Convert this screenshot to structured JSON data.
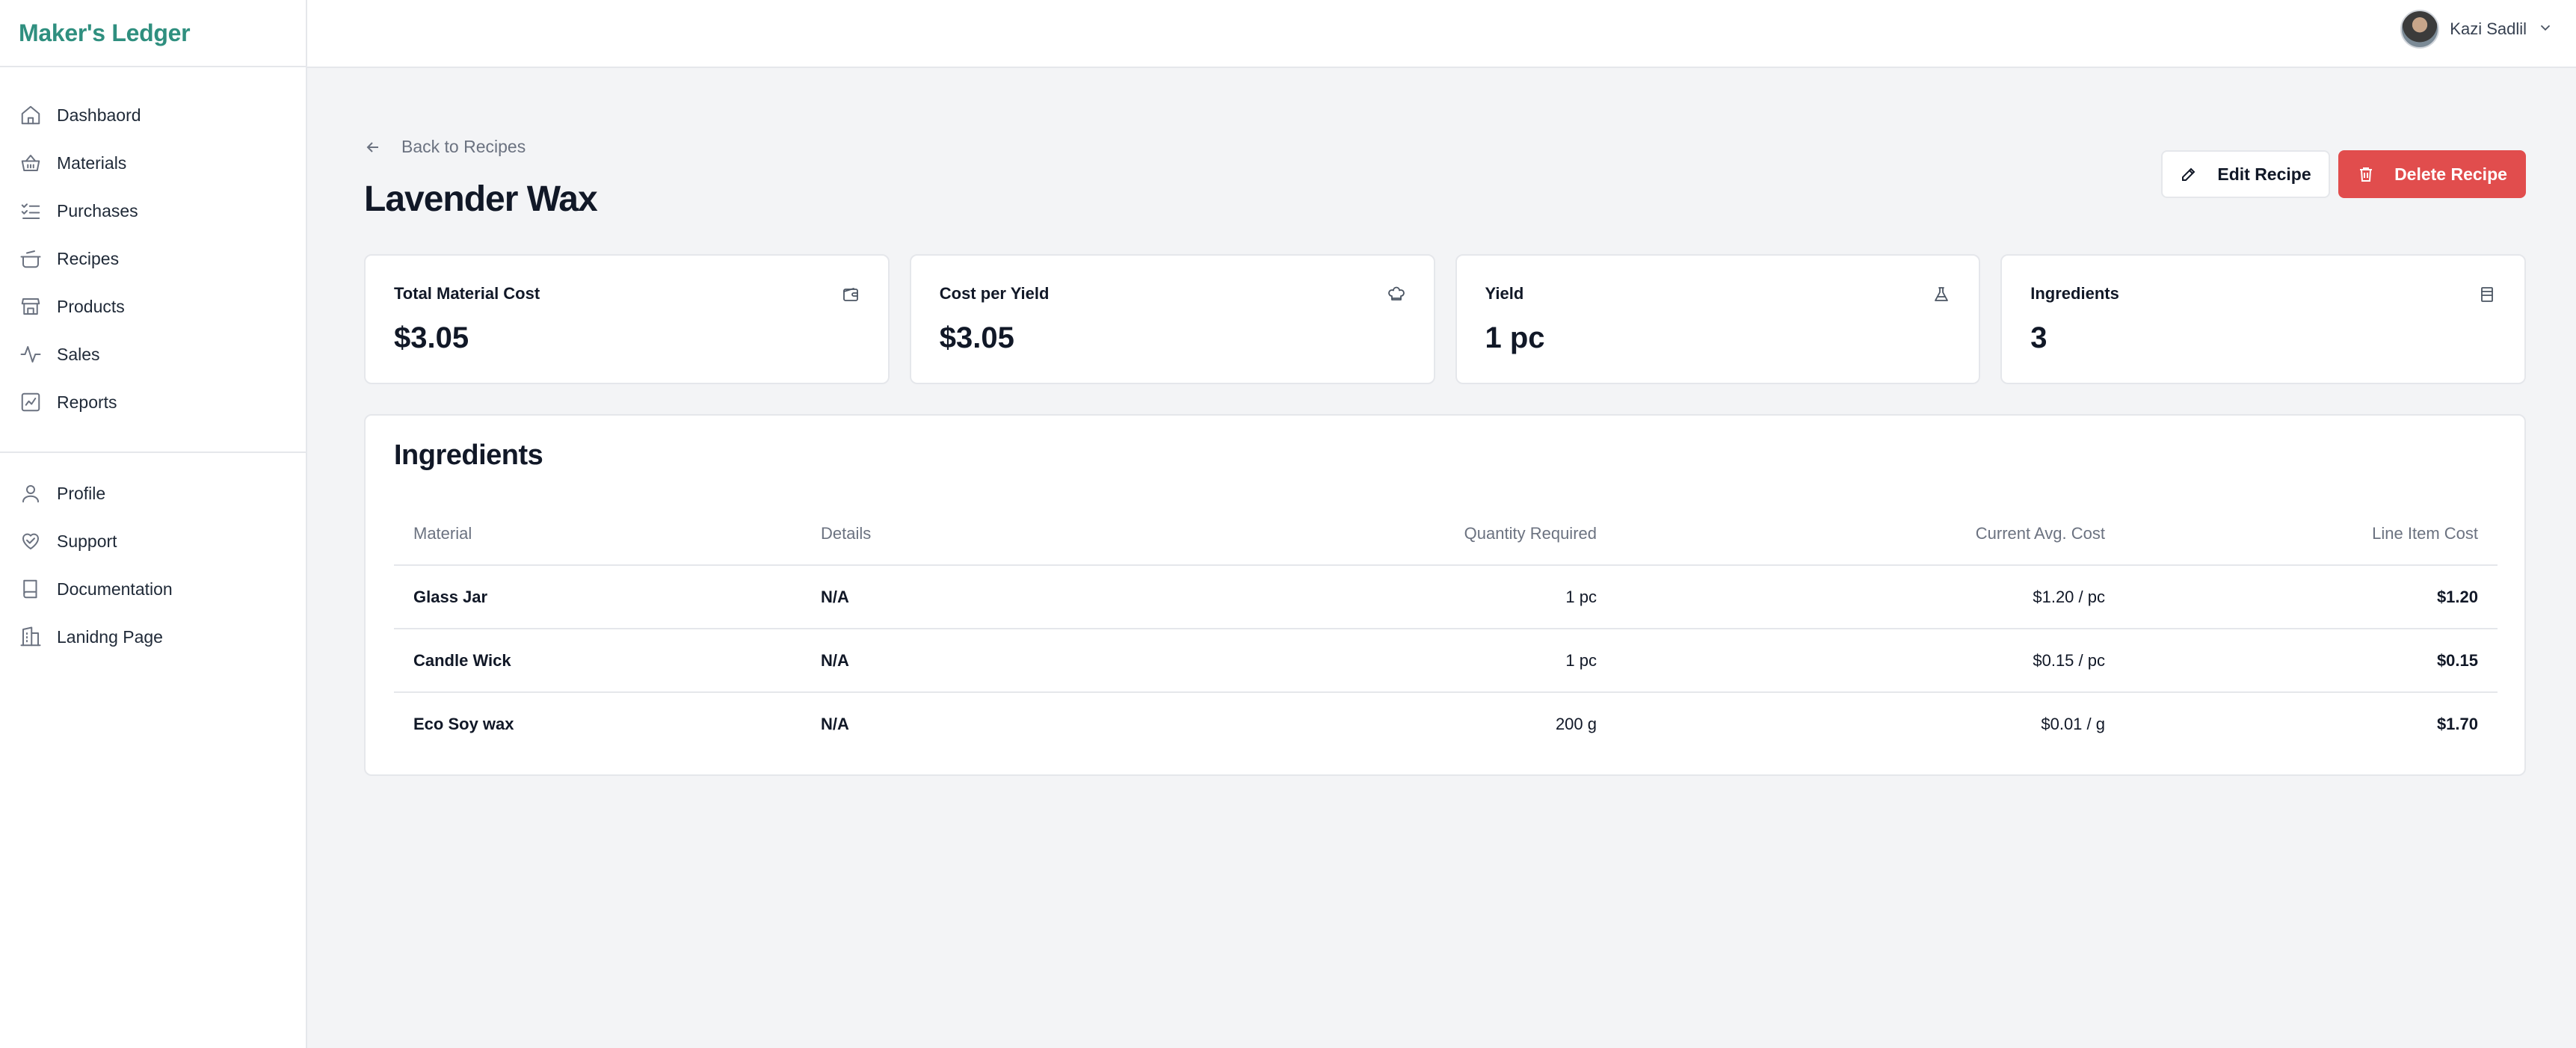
{
  "brand": "Maker's Ledger",
  "sidebar": {
    "items": [
      {
        "label": "Dashbaord"
      },
      {
        "label": "Materials"
      },
      {
        "label": "Purchases"
      },
      {
        "label": "Recipes"
      },
      {
        "label": "Products"
      },
      {
        "label": "Sales"
      },
      {
        "label": "Reports"
      }
    ],
    "secondary": [
      {
        "label": "Profile"
      },
      {
        "label": "Support"
      },
      {
        "label": "Documentation"
      },
      {
        "label": "Lanidng Page"
      }
    ]
  },
  "user": {
    "name": "Kazi Sadlil"
  },
  "page": {
    "back_label": "Back to Recipes",
    "title": "Lavender Wax",
    "edit_label": "Edit Recipe",
    "delete_label": "Delete Recipe"
  },
  "stats": [
    {
      "label": "Total Material Cost",
      "value": "$3.05",
      "icon": "wallet-icon"
    },
    {
      "label": "Cost per Yield",
      "value": "$3.05",
      "icon": "chef-hat-icon"
    },
    {
      "label": "Yield",
      "value": "1 pc",
      "icon": "flask-icon"
    },
    {
      "label": "Ingredients",
      "value": "3",
      "icon": "list-icon"
    }
  ],
  "ingredients": {
    "title": "Ingredients",
    "columns": [
      "Material",
      "Details",
      "Quantity Required",
      "Current Avg. Cost",
      "Line Item Cost"
    ],
    "rows": [
      {
        "material": "Glass Jar",
        "details": "N/A",
        "quantity": "1 pc",
        "avg_cost": "$1.20 / pc",
        "line_cost": "$1.20"
      },
      {
        "material": "Candle Wick",
        "details": "N/A",
        "quantity": "1 pc",
        "avg_cost": "$0.15 / pc",
        "line_cost": "$0.15"
      },
      {
        "material": "Eco Soy wax",
        "details": "N/A",
        "quantity": "200 g",
        "avg_cost": "$0.01 / g",
        "line_cost": "$1.70"
      }
    ]
  },
  "colors": {
    "brand": "#2f8f7f",
    "danger": "#e14d4d",
    "background": "#f3f4f6"
  }
}
